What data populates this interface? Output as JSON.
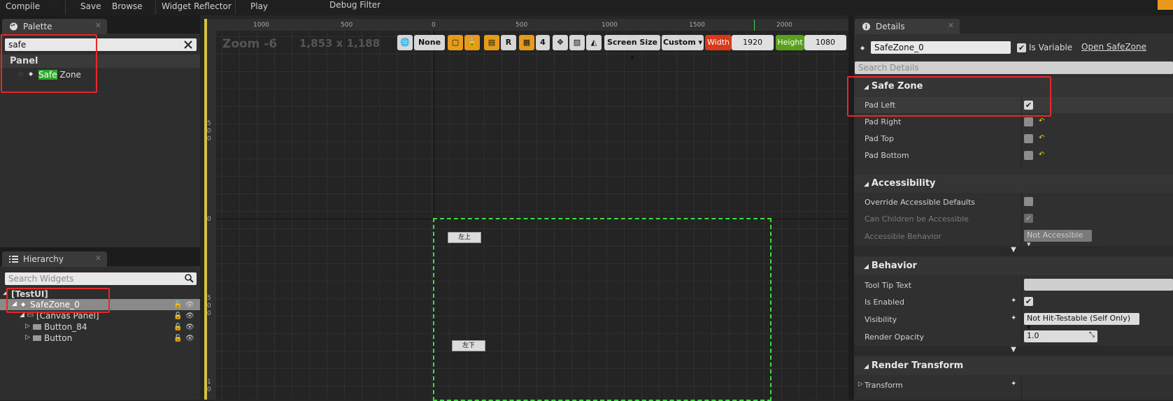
{
  "toolbar": {
    "compile": "Compile",
    "save": "Save",
    "browse": "Browse",
    "reflector": "Widget Reflector",
    "play": "Play",
    "debug_filter": "Debug Filter"
  },
  "palette": {
    "tab": "Palette",
    "close": "✕",
    "search_value": "safe",
    "category": "Panel",
    "item_match": "Safe",
    "item_rest": " Zone"
  },
  "hierarchy": {
    "tab": "Hierarchy",
    "close": "✕",
    "search_placeholder": "Search Widgets",
    "root": "[TestUI]",
    "items": [
      "SafeZone_0",
      "[Canvas Panel]",
      "Button_84",
      "Button"
    ]
  },
  "viewport": {
    "zoom": "Zoom -6",
    "resolution": "1,853 x 1,188",
    "none_label": "None",
    "r_label": "R",
    "grid_num": "4",
    "screen_size": "Screen Size",
    "custom": "Custom",
    "width_label": "Width",
    "width_value": "1920",
    "height_label": "Height",
    "height_value": "1080",
    "ruler_top": [
      "1000",
      "500",
      "0",
      "500",
      "1000",
      "1500",
      "2000"
    ],
    "ruler_left": [
      "5\n0\n0",
      "0",
      "5\n0\n0",
      "1\n0"
    ],
    "btn1": "左上",
    "btn2": "左下"
  },
  "details": {
    "tab": "Details",
    "close": "✕",
    "name_value": "SafeZone_0",
    "is_variable": "Is Variable",
    "open_safezone": "Open SafeZone",
    "search_placeholder": "Search Details",
    "cat_safezone": "Safe Zone",
    "pad_left": "Pad Left",
    "pad_right": "Pad Right",
    "pad_top": "Pad Top",
    "pad_bottom": "Pad Bottom",
    "cat_access": "Accessibility",
    "override": "Override Accessible Defaults",
    "children": "Can Children be Accessible",
    "behavior_prop": "Accessible Behavior",
    "not_accessible": "Not Accessible",
    "cat_behavior": "Behavior",
    "tooltip": "Tool Tip Text",
    "is_enabled": "Is Enabled",
    "visibility": "Visibility",
    "visibility_value": "Not Hit-Testable (Self Only)",
    "render_opacity": "Render Opacity",
    "opacity_value": "1.0",
    "cat_render": "Render Transform",
    "transform": "Transform"
  },
  "colors": {
    "accent_green": "#2eaa2e",
    "highlight_red": "#e82828",
    "width_red": "#d83a1a",
    "height_green": "#5aa01a",
    "orange": "#e89a1a"
  }
}
